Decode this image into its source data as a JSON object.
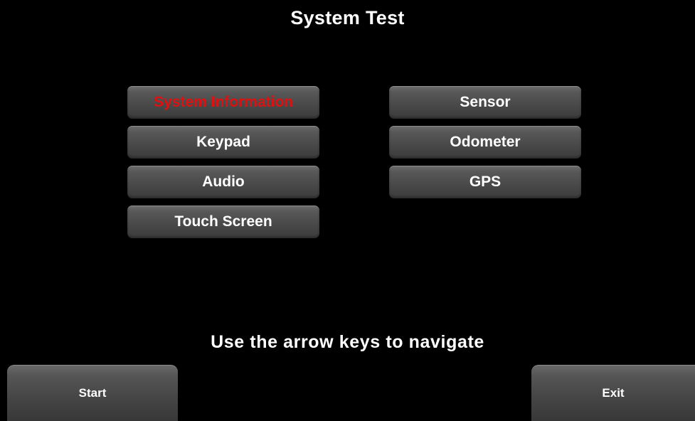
{
  "screen": {
    "title": "System Test",
    "hint": "Use the arrow keys to navigate"
  },
  "menu": {
    "system_information": "System Information",
    "keypad": "Keypad",
    "audio": "Audio",
    "touch_screen": "Touch Screen",
    "sensor": "Sensor",
    "odometer": "Odometer",
    "gps": "GPS",
    "selected": "System Information"
  },
  "footer": {
    "start_label": "Start",
    "exit_label": "Exit"
  },
  "colors": {
    "background": "#000000",
    "text": "#ffffff",
    "selected_text": "#e01010",
    "button": "#4a4a4a"
  }
}
